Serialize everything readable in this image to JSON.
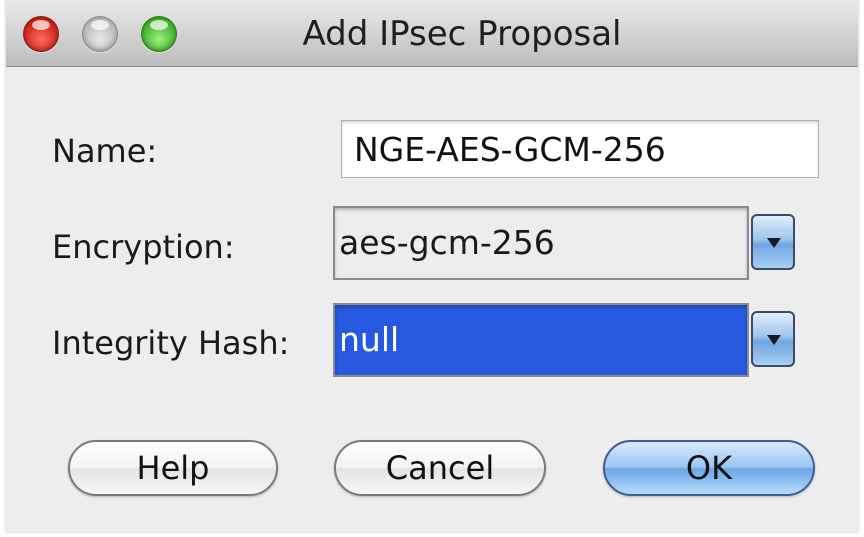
{
  "window": {
    "title": "Add IPsec Proposal"
  },
  "form": {
    "name_label": "Name:",
    "name_value": "NGE-AES-GCM-256",
    "encryption_label": "Encryption:",
    "encryption_value": "aes-gcm-256",
    "integrity_label": "Integrity Hash:",
    "integrity_value": "null"
  },
  "buttons": {
    "help": "Help",
    "cancel": "Cancel",
    "ok": "OK"
  },
  "icons": {
    "close": "close-icon",
    "minimize": "minimize-icon",
    "zoom": "zoom-icon",
    "dropdown": "chevron-down-icon"
  },
  "colors": {
    "selection": "#2659e0",
    "default_button": "#6ba7e7",
    "close": "#c81e14",
    "zoom": "#3cad26"
  }
}
